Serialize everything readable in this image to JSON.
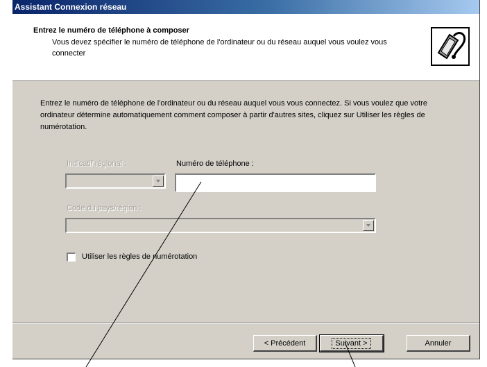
{
  "window": {
    "title": "Assistant Connexion réseau"
  },
  "header": {
    "title": "Entrez le numéro de téléphone à composer",
    "subtitle": "Vous devez spécifier le numéro de téléphone de l'ordinateur ou du réseau auquel vous voulez vous connecter",
    "icon": "phone-modem-icon"
  },
  "body": {
    "intro": "Entrez le numéro de téléphone de l'ordinateur ou du réseau auquel vous vous connectez. Si vous voulez que votre ordinateur détermine automatiquement comment composer à partir d'autres sites, cliquez sur Utiliser les règles de numérotation.",
    "area_code_label": "Indicatif régional :",
    "area_code_value": "",
    "phone_label": "Numéro de téléphone :",
    "phone_value": "",
    "country_label": "Code du pays/région :",
    "country_value": "",
    "dialing_rules_label": "Utiliser les règles de numérotation",
    "dialing_rules_checked": false
  },
  "buttons": {
    "back": "< Précédent",
    "next": "Suivant >",
    "cancel": "Annuler"
  },
  "colors": {
    "dialog_bg": "#d4d0c8",
    "title_start": "#0a246a",
    "title_end": "#a6caf0"
  }
}
